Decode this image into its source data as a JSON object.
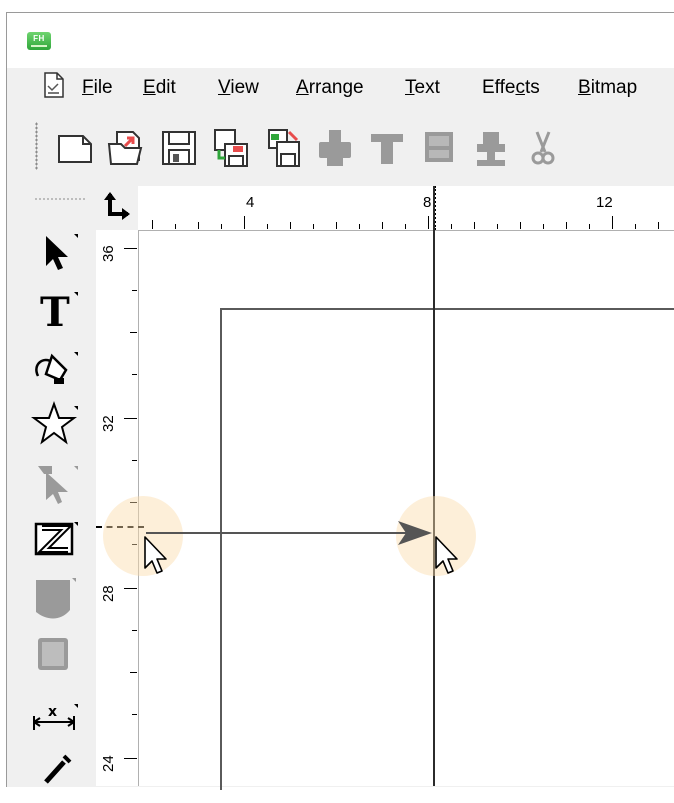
{
  "app": {
    "icon_label": "FH"
  },
  "menu": {
    "items": [
      {
        "pre": "",
        "key": "F",
        "post": "ile"
      },
      {
        "pre": "",
        "key": "E",
        "post": "dit"
      },
      {
        "pre": "",
        "key": "V",
        "post": "iew"
      },
      {
        "pre": "",
        "key": "A",
        "post": "rrange"
      },
      {
        "pre": "",
        "key": "T",
        "post": "ext"
      },
      {
        "pre": "Effe",
        "key": "c",
        "post": "ts"
      },
      {
        "pre": "",
        "key": "B",
        "post": "itmap"
      }
    ]
  },
  "toolbar": {
    "buttons": [
      "new-document-icon",
      "open-file-icon",
      "save-icon",
      "save-as-icon",
      "save-all-icon",
      "print-icon",
      "paste-special-icon",
      "import-icon",
      "export-icon",
      "cut-icon"
    ]
  },
  "rulers": {
    "horizontal_labels": [
      "4",
      "8",
      "12"
    ],
    "vertical_labels": [
      "36",
      "32",
      "28",
      "24"
    ]
  },
  "tools": [
    "pointer-tool-icon",
    "text-tool-icon",
    "pen-tool-icon",
    "star-tool-icon",
    "subselect-tool-icon",
    "blend-tool-icon",
    "shape-tool-icon",
    "rectangle-tool-icon",
    "dimension-tool-icon",
    "eyedropper-tool-icon"
  ],
  "colors": {
    "chrome": "#f0f0f0",
    "ruler": "#ffffff",
    "canvas": "#ffffff",
    "guide": "#2b2b2b",
    "halo": "#fadcaa",
    "accent_green": "#2fa63a",
    "accent_red": "#e84c4c"
  }
}
